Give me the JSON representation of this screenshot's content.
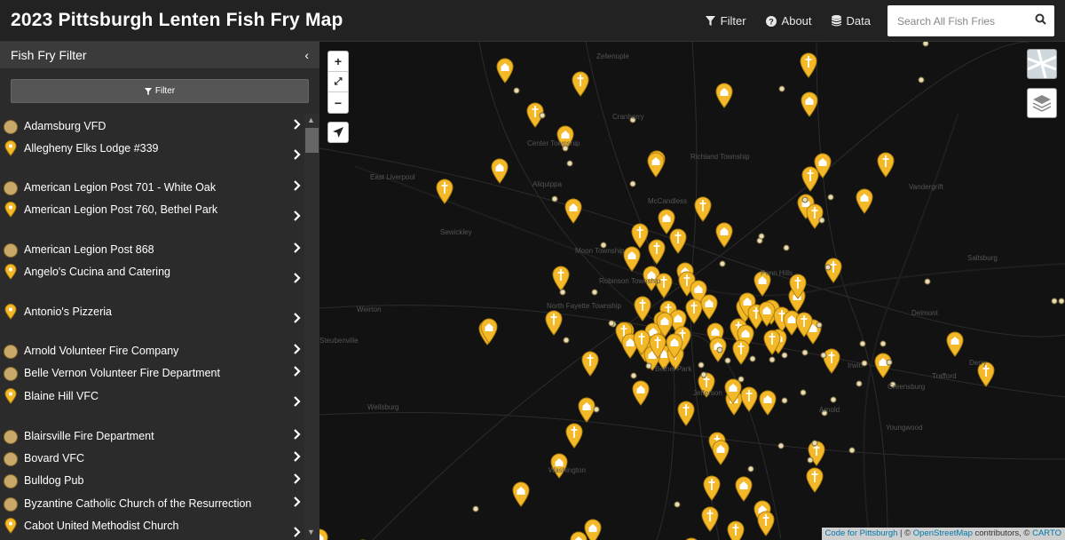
{
  "header": {
    "title": "2023 Pittsburgh Lenten Fish Fry Map",
    "nav": [
      {
        "label": "Filter",
        "icon": "filter-icon"
      },
      {
        "label": "About",
        "icon": "question-circle-icon"
      },
      {
        "label": "Data",
        "icon": "database-icon"
      }
    ],
    "search_placeholder": "Search All Fish Fries"
  },
  "sidebar": {
    "title": "Fish Fry Filter",
    "collapse_glyph": "‹",
    "filter_button_label": "Filter",
    "items": [
      {
        "label": "Adamsburg VFD",
        "icon": "fire-dept-circle"
      },
      {
        "label": "Allegheny Elks Lodge #339",
        "icon": "pin"
      },
      {
        "label": "American Legion Post 701 - White Oak",
        "icon": "fire-dept-circle"
      },
      {
        "label": "American Legion Post 760, Bethel Park",
        "icon": "pin"
      },
      {
        "label": "American Legion Post 868",
        "icon": "fire-dept-circle"
      },
      {
        "label": "Angelo's Cucina and Catering",
        "icon": "pin"
      },
      {
        "label": "Antonio's Pizzeria",
        "icon": "pin"
      },
      {
        "label": "Arnold Volunteer Fire Company",
        "icon": "fire-dept-circle"
      },
      {
        "label": "Belle Vernon Volunteer Fire Department",
        "icon": "fire-dept-circle"
      },
      {
        "label": "Blaine Hill VFC",
        "icon": "pin"
      },
      {
        "label": "Blairsville Fire Department",
        "icon": "fire-dept-circle"
      },
      {
        "label": "Bovard VFC",
        "icon": "fire-dept-circle"
      },
      {
        "label": "Bulldog Pub",
        "icon": "fire-dept-circle"
      },
      {
        "label": "Byzantine Catholic Church of the Resurrection",
        "icon": "fire-dept-circle"
      },
      {
        "label": "Cabot United Methodist Church",
        "icon": "pin"
      }
    ]
  },
  "map": {
    "controls": {
      "zoom_in": "+",
      "fit": "⤢",
      "zoom_out": "−"
    },
    "places": [
      "Zelienople",
      "Cranberry",
      "Center Township",
      "Richland Township",
      "East Liverpool",
      "Aliquippa",
      "McCandless",
      "Vandergrift",
      "Moon Township",
      "Robinson Township",
      "Penn Hills",
      "Saltsburg",
      "Weirton",
      "North Fayette Township",
      "Delmont",
      "Steubenville",
      "Irwin",
      "Greensburg",
      "Bethel Park",
      "Jefferson",
      "Wellsburg",
      "Arnold",
      "Youngwood",
      "Washington",
      "Derry",
      "Trafford",
      "Sewickley"
    ],
    "attribution": {
      "link1": "Code for Pittsburgh",
      "sep": " | © ",
      "link2": "OpenStreetMap",
      "mid": " contributors, © ",
      "link3": "CARTO"
    }
  },
  "colors": {
    "marker": "#f3b928",
    "marker_stroke": "#b07e0c",
    "topbar": "#222222",
    "sidebar": "#2b2b2b",
    "map_bg": "#121212"
  }
}
